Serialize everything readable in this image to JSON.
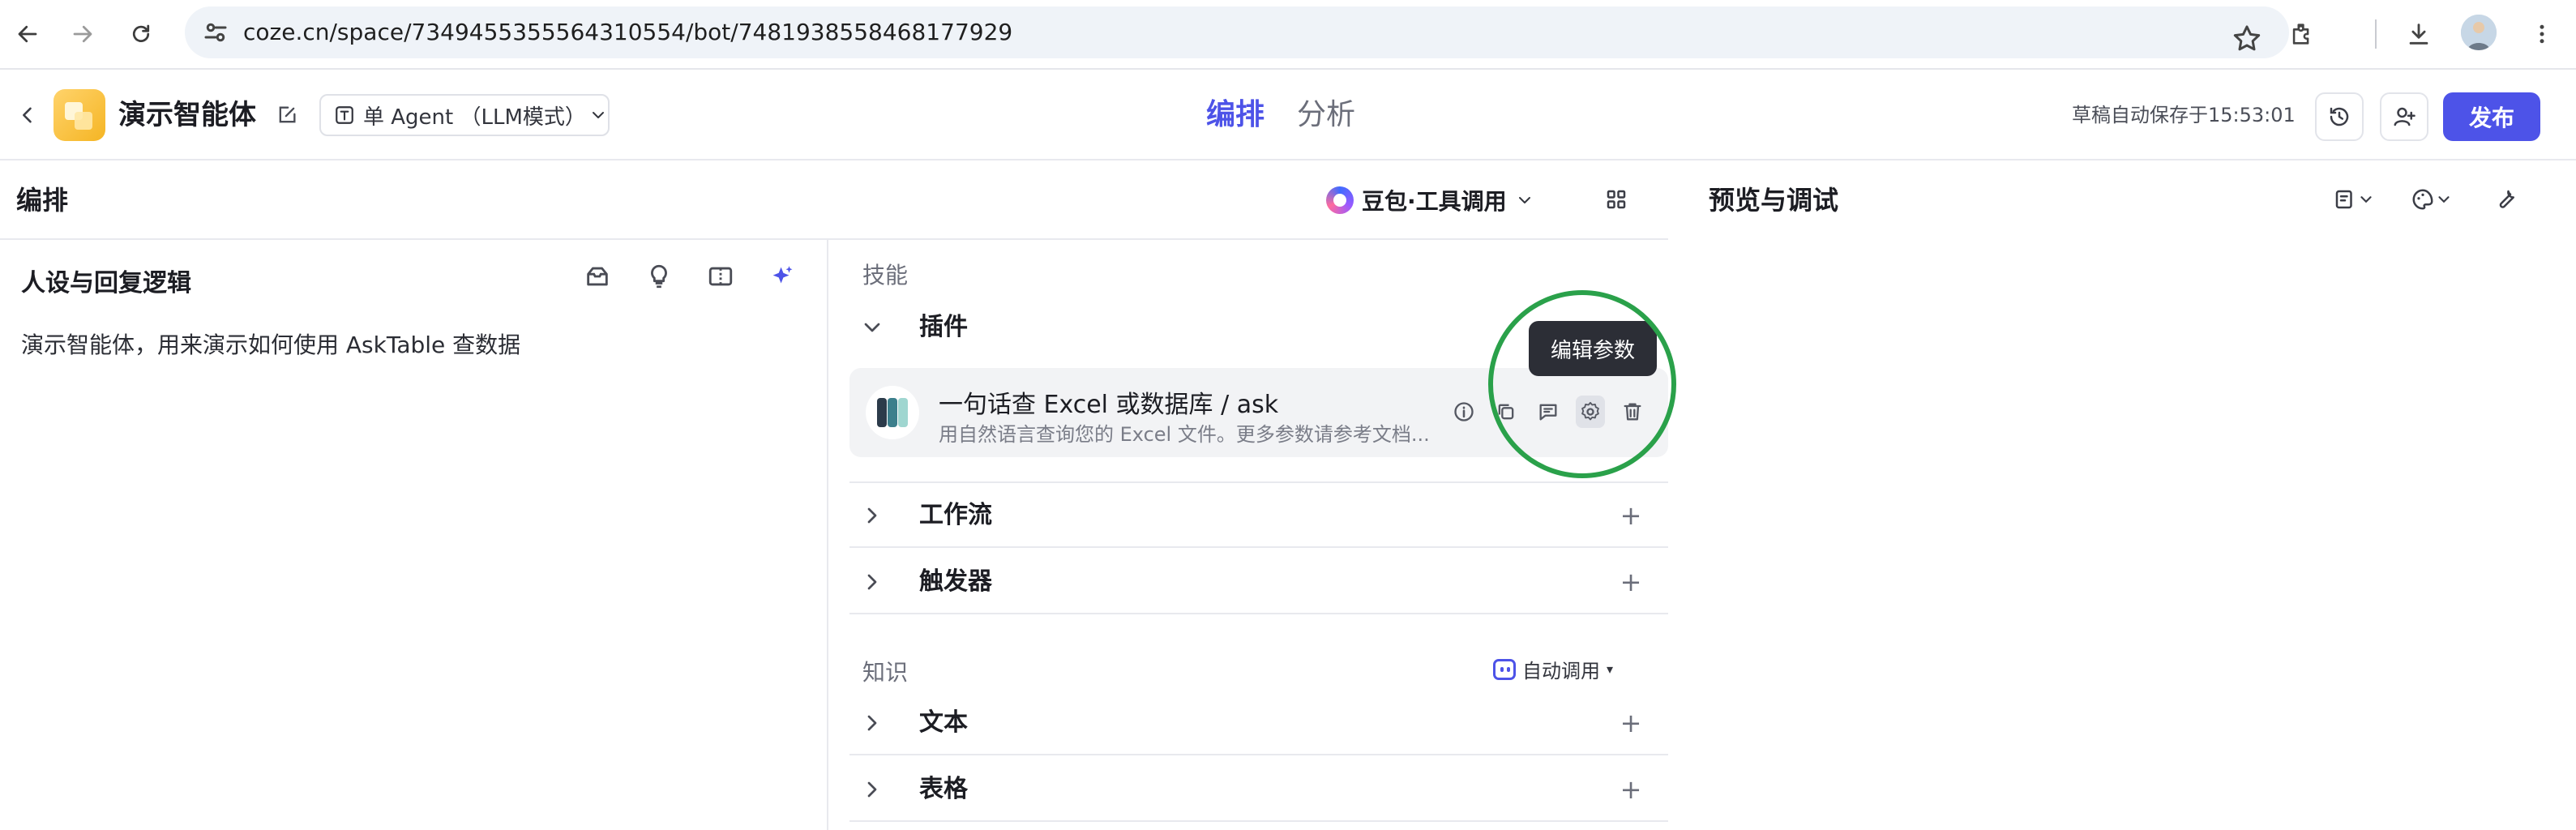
{
  "browser": {
    "url": "coze.cn/space/7349455355564310554/bot/7481938558468177929"
  },
  "header": {
    "bot_name": "演示智能体",
    "mode_label": "单 Agent （LLM模式）",
    "tabs": [
      {
        "label": "编排",
        "active": true
      },
      {
        "label": "分析",
        "active": false
      }
    ],
    "autosave": "草稿自动保存于15:53:01",
    "publish_label": "发布",
    "accent_color": "#4d53e8"
  },
  "orchestrate": {
    "title": "编排",
    "model": "豆包·工具调用"
  },
  "persona": {
    "title": "人设与回复逻辑",
    "text": "演示智能体，用来演示如何使用 AskTable 查数据"
  },
  "skills": {
    "section_label": "技能",
    "plugins_label": "插件",
    "plugin": {
      "name": "一句话查 Excel 或数据库 / ask",
      "description": "用自然语言查询您的 Excel 文件。更多参数请参考文档..."
    },
    "tooltip": "编辑参数",
    "workflow_label": "工作流",
    "trigger_label": "触发器"
  },
  "knowledge": {
    "section_label": "知识",
    "auto_call_label": "自动调用",
    "text_label": "文本",
    "table_label": "表格"
  },
  "preview": {
    "title": "预览与调试"
  },
  "annotation": {
    "circle_color": "#2aa14a"
  }
}
